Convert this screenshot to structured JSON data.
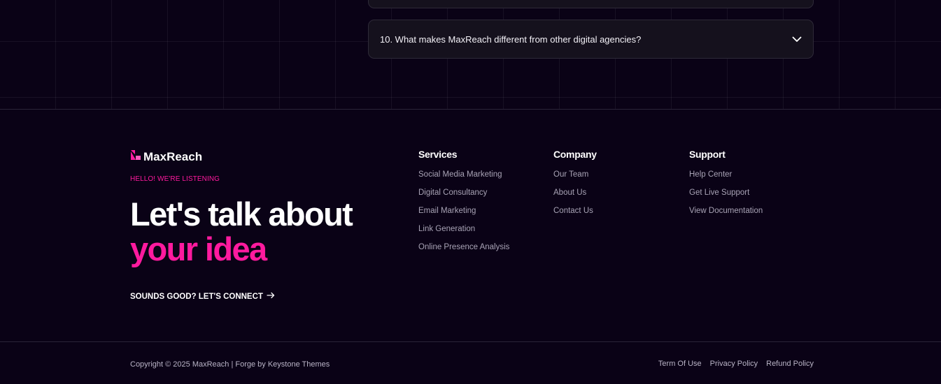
{
  "faq": {
    "question_10": "10. What makes MaxReach different from other digital agencies?",
    "toggle_icon": "chevron-down-icon"
  },
  "brand": {
    "name": "MaxReach",
    "logo_icon": "maxreach-logo-icon",
    "accent_color": "#ff1a9e"
  },
  "hero": {
    "eyebrow": "HELLO! WE'RE LISTENING",
    "headline_line1": "Let's talk about",
    "headline_line2": "your idea",
    "cta_label": "SOUNDS GOOD? LET'S CONNECT",
    "cta_icon": "arrow-right-icon"
  },
  "columns": {
    "services": {
      "title": "Services",
      "items": [
        "Social Media Marketing",
        "Digital Consultancy",
        "Email Marketing",
        "Link Generation",
        "Online Presence Analysis"
      ]
    },
    "company": {
      "title": "Company",
      "items": [
        "Our Team",
        "About Us",
        "Contact Us"
      ]
    },
    "support": {
      "title": "Support",
      "items": [
        "Help Center",
        "Get Live Support",
        "View Documentation"
      ]
    }
  },
  "footer": {
    "copyright": "Copyright © 2025 MaxReach | Forge by Keystone Themes",
    "links": [
      "Term Of Use",
      "Privacy Policy",
      "Refund Policy"
    ]
  },
  "colors": {
    "background": "#0a0216",
    "card": "#15111d",
    "muted_text": "#a8a3b5"
  }
}
